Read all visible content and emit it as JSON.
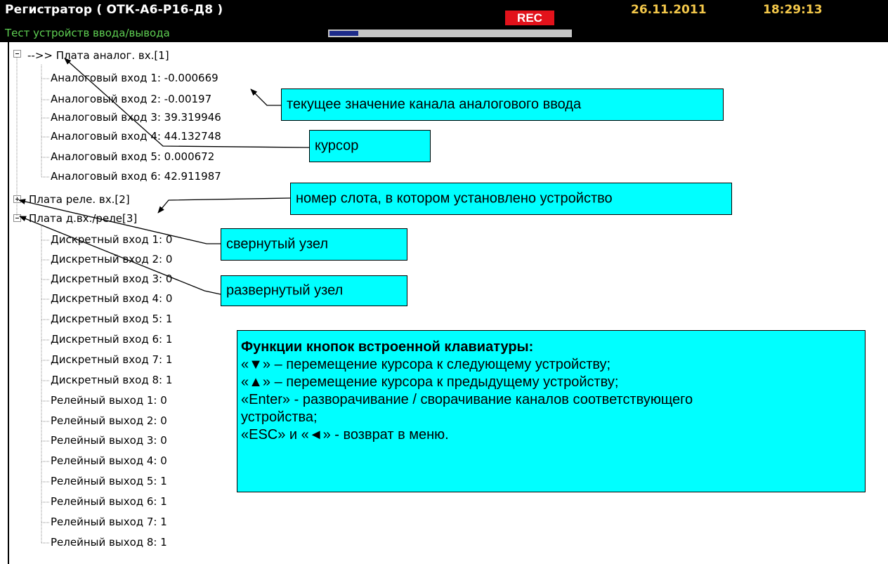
{
  "header": {
    "app_title": "Регистратор ( ОТК-А6-Р16-Д8 )",
    "subtitle": "Тест устройств ввода/вывода",
    "rec_label": "REC",
    "date": "26.11.2011",
    "time": "18:29:13",
    "progress_fraction": 0.12,
    "colors": {
      "background": "#000000",
      "title": "#ffffff",
      "subtitle": "#5ecf52",
      "rec": "#e2121b",
      "datetime": "#f4c84a",
      "progress_fill": "#1d2b8a",
      "progress_track": "#c6c6c6"
    }
  },
  "tree": {
    "nodes": [
      {
        "label": "Плата аналог. вх.[1]",
        "cursor": "-->>",
        "expanded": true,
        "children": [
          "Аналоговый вход 1: -0.000669",
          "Аналоговый вход 2: -0.00197",
          "Аналоговый вход 3: 39.319946",
          "Аналоговый вход 4: 44.132748",
          "Аналоговый вход 5: 0.000672",
          "Аналоговый вход 6: 42.911987"
        ]
      },
      {
        "label": "Плата реле. вх.[2]",
        "expanded": false,
        "children": []
      },
      {
        "label": "Плата д.вх./реле[3]",
        "expanded": true,
        "children": [
          "Дискретный вход 1: 0",
          "Дискретный вход 2: 0",
          "Дискретный вход 3: 0",
          "Дискретный вход 4: 0",
          "Дискретный вход 5: 1",
          "Дискретный вход 6: 1",
          "Дискретный вход 7: 1",
          "Дискретный вход 8: 1",
          "Релейный выход 1: 0",
          "Релейный выход 2: 0",
          "Релейный выход 3: 0",
          "Релейный выход 4: 0",
          "Релейный выход 5: 1",
          "Релейный выход 6: 1",
          "Релейный выход 7: 1",
          "Релейный выход 8: 1"
        ]
      }
    ]
  },
  "callouts": {
    "current_value": "текущее значение канала аналогового ввода",
    "cursor": "курсор",
    "slot_number": "номер слота, в котором установлено устройство",
    "collapsed_node": "свернутый узел",
    "expanded_node": "развернутый узел",
    "color": "#00ffff"
  },
  "help": {
    "title": "Функции кнопок встроенной клавиатуры:",
    "lines": [
      "«▼» – перемещение курсора к следующему устройству;",
      "«▲» – перемещение курсора к предыдущему устройству;",
      "«Enter» - разворачивание / сворачивание каналов соответствующего",
      "устройства;",
      "«ESC» и «◄» - возврат в меню."
    ]
  }
}
